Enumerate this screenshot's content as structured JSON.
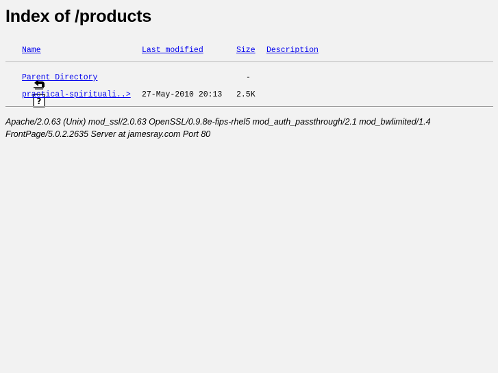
{
  "page": {
    "title": "Index of /products"
  },
  "columns": {
    "name": "Name",
    "last_modified": "Last modified",
    "size": "Size",
    "description": "Description"
  },
  "rows": [
    {
      "icon": "back-arrow-icon",
      "name": "Parent Directory",
      "last_modified": "",
      "size": "-",
      "description": ""
    },
    {
      "icon": "unknown-file-icon",
      "name": "practical-spirituali..>",
      "last_modified": "27-May-2010 20:13",
      "size": "2.5K",
      "description": ""
    }
  ],
  "footer": {
    "line1": "Apache/2.0.63 (Unix) mod_ssl/2.0.63 OpenSSL/0.9.8e-fips-rhel5 mod_auth_passthrough/2.1 mod_bwlimited/1.4",
    "line2": "FrontPage/5.0.2.2635 Server at jamesray.com Port 80"
  },
  "colors": {
    "background": "#f2f2f2",
    "link": "#0000ee",
    "rule": "#9a9a9a"
  }
}
